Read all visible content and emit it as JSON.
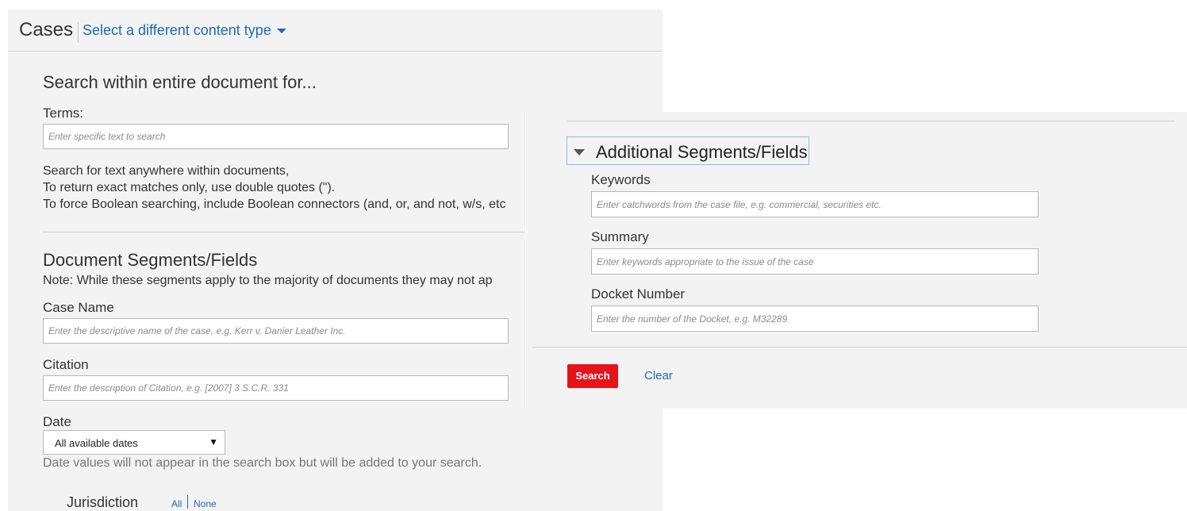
{
  "header": {
    "title": "Cases",
    "content_type_link": "Select a different content type"
  },
  "search_section": {
    "heading": "Search within entire document for...",
    "terms_label": "Terms:",
    "terms_placeholder": "Enter specific text to search",
    "help_line1": "Search for text anywhere within documents,",
    "help_line2": "To return exact matches only, use double quotes (\").",
    "help_line3": "To force Boolean searching, include Boolean connectors (and, or, and not, w/s, etc"
  },
  "segments_section": {
    "heading": "Document Segments/Fields",
    "note": "Note: While these segments apply to the majority of documents they may not ap",
    "case_name_label": "Case Name",
    "case_name_placeholder": "Enter the descriptive name of the case, e.g. Kerr v. Danier Leather Inc.",
    "citation_label": "Citation",
    "citation_placeholder": "Enter the description of Citation, e.g. [2007] 3 S.C.R. 331",
    "date_label": "Date",
    "date_selected": "All available dates",
    "date_hint": "Date values will not appear in the search box but will be added to your search.",
    "jurisdiction_label": "Jurisdiction",
    "jurisdiction_all": "All",
    "jurisdiction_none": "None"
  },
  "additional": {
    "heading": "Additional Segments/Fields",
    "keywords_label": "Keywords",
    "keywords_placeholder": "Enter catchwords from the case file, e.g. commercial, securities etc.",
    "summary_label": "Summary",
    "summary_placeholder": "Enter keywords appropriate to the issue of the case",
    "docket_label": "Docket Number",
    "docket_placeholder": "Enter the number of the Docket, e.g. M32289"
  },
  "actions": {
    "search_label": "Search",
    "clear_label": "Clear"
  },
  "colors": {
    "link": "#1d6cb8",
    "search_button": "#e6131b",
    "panel_bg": "#f3f3f3"
  }
}
